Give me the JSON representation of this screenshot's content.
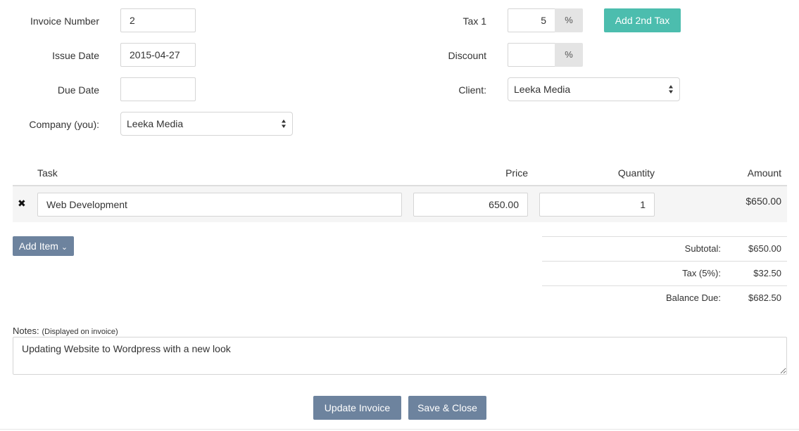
{
  "form": {
    "invoice_number_label": "Invoice Number",
    "invoice_number_value": "2",
    "issue_date_label": "Issue Date",
    "issue_date_value": "2015-04-27",
    "due_date_label": "Due Date",
    "due_date_value": "",
    "company_label": "Company (you):",
    "company_value": "Leeka Media",
    "tax1_label": "Tax 1",
    "tax1_value": "5",
    "tax1_unit": "%",
    "add_tax_label": "Add 2nd Tax",
    "discount_label": "Discount",
    "discount_value": "",
    "discount_unit": "%",
    "client_label": "Client:",
    "client_value": "Leeka Media"
  },
  "table": {
    "headers": {
      "task": "Task",
      "price": "Price",
      "quantity": "Quantity",
      "amount": "Amount"
    },
    "rows": [
      {
        "remove_glyph": "✖",
        "task": "Web Development",
        "price": "650.00",
        "quantity": "1",
        "amount": "$650.00"
      }
    ],
    "add_item_label": "Add Item",
    "add_item_caret": "⌄"
  },
  "totals": {
    "subtotal_label": "Subtotal:",
    "subtotal_value": "$650.00",
    "tax_label": "Tax (5%):",
    "tax_value": "$32.50",
    "balance_label": "Balance Due:",
    "balance_value": "$682.50"
  },
  "notes": {
    "label": "Notes:",
    "hint": "(Displayed on invoice)",
    "value": "Updating Website to Wordpress with a new look"
  },
  "actions": {
    "update_label": "Update Invoice",
    "save_close_label": "Save & Close"
  },
  "colors": {
    "teal_button": "#4cbdae",
    "slate_button": "#6d839e",
    "addon_bg": "#e4e4e4",
    "row_bg": "#f5f5f5"
  },
  "icons": {
    "remove": "close-icon",
    "select_arrows": "sort-arrows-icon"
  }
}
